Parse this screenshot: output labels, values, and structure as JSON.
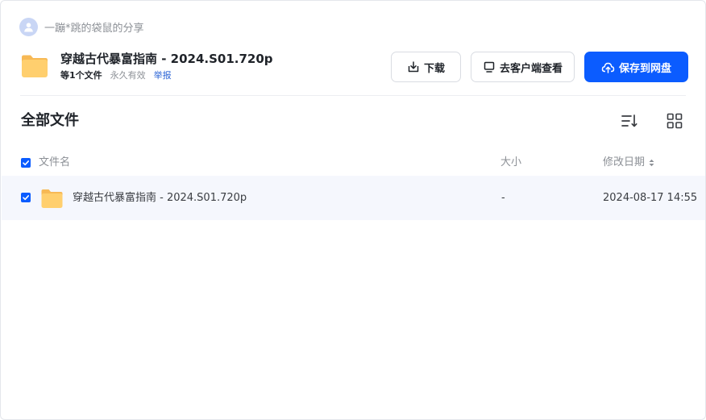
{
  "share": {
    "owner_text": "一蹦*跳的袋鼠的分享"
  },
  "header": {
    "title": "穿越古代暴富指南 - 2024.S01.720p",
    "file_count": "等1个文件",
    "validity": "永久有效",
    "report": "举报"
  },
  "buttons": {
    "download": "下载",
    "open_client": "去客户端查看",
    "save": "保存到网盘"
  },
  "section": {
    "title": "全部文件"
  },
  "columns": {
    "name": "文件名",
    "size": "大小",
    "modified": "修改日期"
  },
  "files": [
    {
      "name": "穿越古代暴富指南 - 2024.S01.720p",
      "size": "-",
      "modified": "2024-08-17 14:55"
    }
  ],
  "colors": {
    "accent": "#0b5cff",
    "folder": "#ffcf6e",
    "row_highlight": "#f5f7fd"
  }
}
